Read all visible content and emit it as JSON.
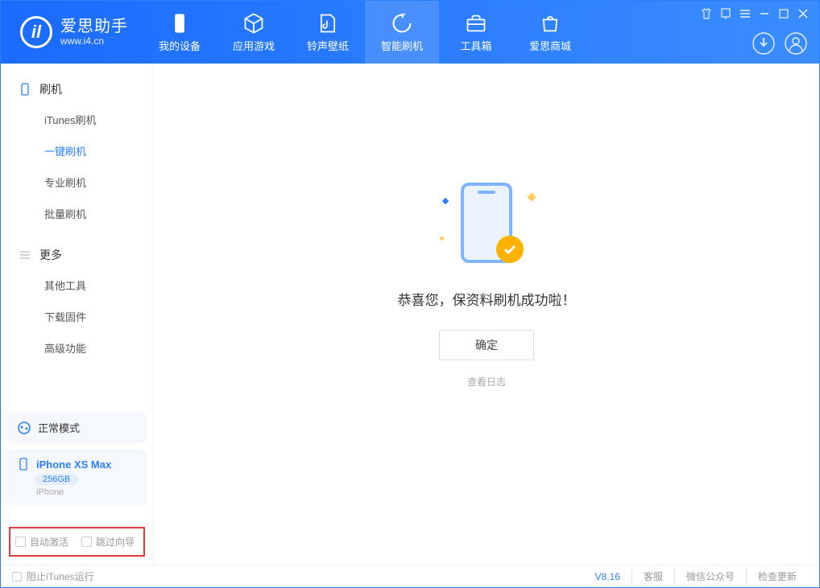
{
  "app": {
    "name": "爱思助手",
    "url": "www.i4.cn"
  },
  "nav": {
    "items": [
      {
        "label": "我的设备"
      },
      {
        "label": "应用游戏"
      },
      {
        "label": "铃声壁纸"
      },
      {
        "label": "智能刷机"
      },
      {
        "label": "工具箱"
      },
      {
        "label": "爱思商城"
      }
    ]
  },
  "sidebar": {
    "section1_title": "刷机",
    "section1_items": [
      {
        "label": "iTunes刷机"
      },
      {
        "label": "一键刷机"
      },
      {
        "label": "专业刷机"
      },
      {
        "label": "批量刷机"
      }
    ],
    "section2_title": "更多",
    "section2_items": [
      {
        "label": "其他工具"
      },
      {
        "label": "下载固件"
      },
      {
        "label": "高级功能"
      }
    ],
    "mode": "正常模式",
    "device_name": "iPhone XS Max",
    "device_cap": "256GB",
    "device_sub": "iPhone",
    "cb1": "自动激活",
    "cb2": "跳过向导"
  },
  "content": {
    "message": "恭喜您，保资料刷机成功啦！",
    "ok": "确定",
    "view_log": "查看日志"
  },
  "statusbar": {
    "block_itunes": "阻止iTunes运行",
    "version": "V8.16",
    "link1": "客服",
    "link2": "微信公众号",
    "link3": "检查更新"
  }
}
